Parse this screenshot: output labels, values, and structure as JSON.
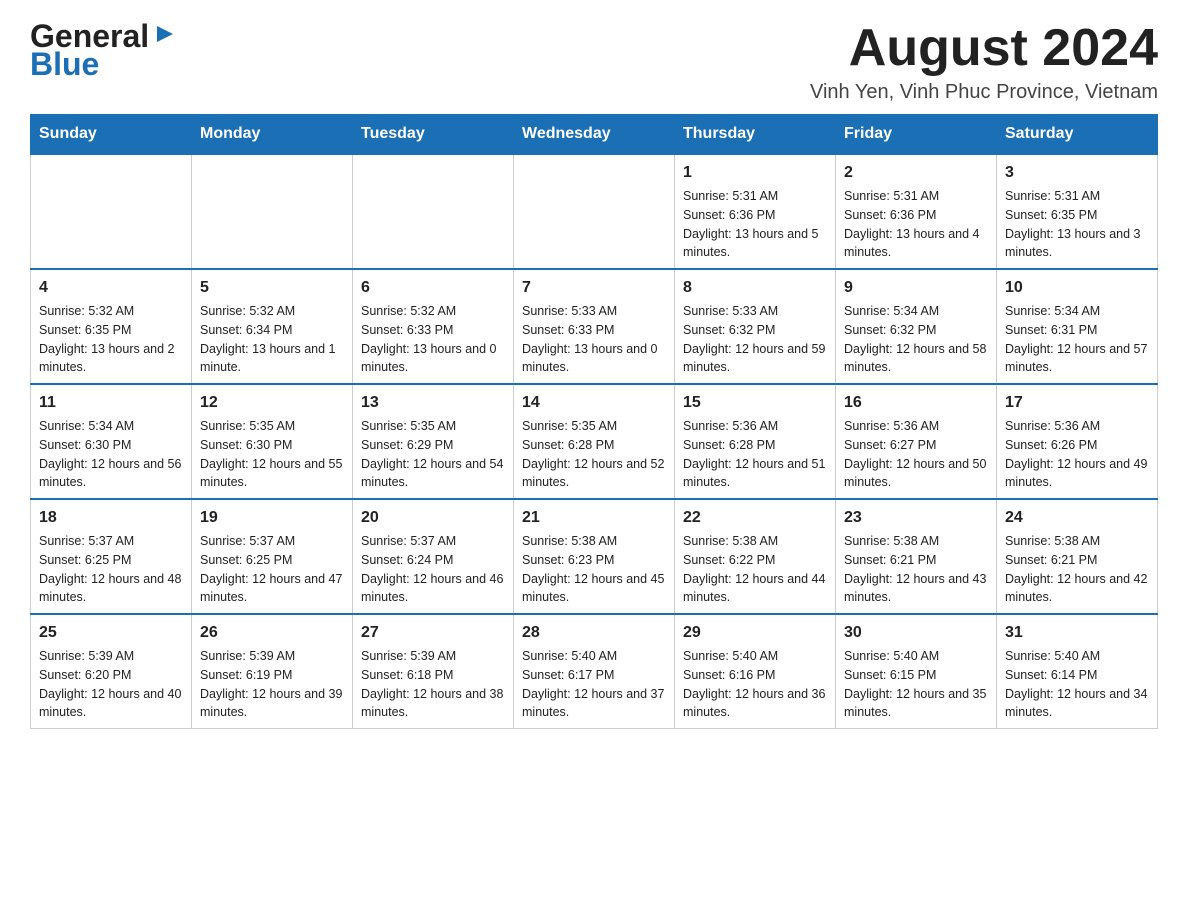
{
  "header": {
    "logo_general": "General",
    "logo_blue": "Blue",
    "main_title": "August 2024",
    "subtitle": "Vinh Yen, Vinh Phuc Province, Vietnam"
  },
  "days_of_week": [
    "Sunday",
    "Monday",
    "Tuesday",
    "Wednesday",
    "Thursday",
    "Friday",
    "Saturday"
  ],
  "weeks": [
    {
      "days": [
        {
          "num": "",
          "info": ""
        },
        {
          "num": "",
          "info": ""
        },
        {
          "num": "",
          "info": ""
        },
        {
          "num": "",
          "info": ""
        },
        {
          "num": "1",
          "info": "Sunrise: 5:31 AM\nSunset: 6:36 PM\nDaylight: 13 hours and 5 minutes."
        },
        {
          "num": "2",
          "info": "Sunrise: 5:31 AM\nSunset: 6:36 PM\nDaylight: 13 hours and 4 minutes."
        },
        {
          "num": "3",
          "info": "Sunrise: 5:31 AM\nSunset: 6:35 PM\nDaylight: 13 hours and 3 minutes."
        }
      ]
    },
    {
      "days": [
        {
          "num": "4",
          "info": "Sunrise: 5:32 AM\nSunset: 6:35 PM\nDaylight: 13 hours and 2 minutes."
        },
        {
          "num": "5",
          "info": "Sunrise: 5:32 AM\nSunset: 6:34 PM\nDaylight: 13 hours and 1 minute."
        },
        {
          "num": "6",
          "info": "Sunrise: 5:32 AM\nSunset: 6:33 PM\nDaylight: 13 hours and 0 minutes."
        },
        {
          "num": "7",
          "info": "Sunrise: 5:33 AM\nSunset: 6:33 PM\nDaylight: 13 hours and 0 minutes."
        },
        {
          "num": "8",
          "info": "Sunrise: 5:33 AM\nSunset: 6:32 PM\nDaylight: 12 hours and 59 minutes."
        },
        {
          "num": "9",
          "info": "Sunrise: 5:34 AM\nSunset: 6:32 PM\nDaylight: 12 hours and 58 minutes."
        },
        {
          "num": "10",
          "info": "Sunrise: 5:34 AM\nSunset: 6:31 PM\nDaylight: 12 hours and 57 minutes."
        }
      ]
    },
    {
      "days": [
        {
          "num": "11",
          "info": "Sunrise: 5:34 AM\nSunset: 6:30 PM\nDaylight: 12 hours and 56 minutes."
        },
        {
          "num": "12",
          "info": "Sunrise: 5:35 AM\nSunset: 6:30 PM\nDaylight: 12 hours and 55 minutes."
        },
        {
          "num": "13",
          "info": "Sunrise: 5:35 AM\nSunset: 6:29 PM\nDaylight: 12 hours and 54 minutes."
        },
        {
          "num": "14",
          "info": "Sunrise: 5:35 AM\nSunset: 6:28 PM\nDaylight: 12 hours and 52 minutes."
        },
        {
          "num": "15",
          "info": "Sunrise: 5:36 AM\nSunset: 6:28 PM\nDaylight: 12 hours and 51 minutes."
        },
        {
          "num": "16",
          "info": "Sunrise: 5:36 AM\nSunset: 6:27 PM\nDaylight: 12 hours and 50 minutes."
        },
        {
          "num": "17",
          "info": "Sunrise: 5:36 AM\nSunset: 6:26 PM\nDaylight: 12 hours and 49 minutes."
        }
      ]
    },
    {
      "days": [
        {
          "num": "18",
          "info": "Sunrise: 5:37 AM\nSunset: 6:25 PM\nDaylight: 12 hours and 48 minutes."
        },
        {
          "num": "19",
          "info": "Sunrise: 5:37 AM\nSunset: 6:25 PM\nDaylight: 12 hours and 47 minutes."
        },
        {
          "num": "20",
          "info": "Sunrise: 5:37 AM\nSunset: 6:24 PM\nDaylight: 12 hours and 46 minutes."
        },
        {
          "num": "21",
          "info": "Sunrise: 5:38 AM\nSunset: 6:23 PM\nDaylight: 12 hours and 45 minutes."
        },
        {
          "num": "22",
          "info": "Sunrise: 5:38 AM\nSunset: 6:22 PM\nDaylight: 12 hours and 44 minutes."
        },
        {
          "num": "23",
          "info": "Sunrise: 5:38 AM\nSunset: 6:21 PM\nDaylight: 12 hours and 43 minutes."
        },
        {
          "num": "24",
          "info": "Sunrise: 5:38 AM\nSunset: 6:21 PM\nDaylight: 12 hours and 42 minutes."
        }
      ]
    },
    {
      "days": [
        {
          "num": "25",
          "info": "Sunrise: 5:39 AM\nSunset: 6:20 PM\nDaylight: 12 hours and 40 minutes."
        },
        {
          "num": "26",
          "info": "Sunrise: 5:39 AM\nSunset: 6:19 PM\nDaylight: 12 hours and 39 minutes."
        },
        {
          "num": "27",
          "info": "Sunrise: 5:39 AM\nSunset: 6:18 PM\nDaylight: 12 hours and 38 minutes."
        },
        {
          "num": "28",
          "info": "Sunrise: 5:40 AM\nSunset: 6:17 PM\nDaylight: 12 hours and 37 minutes."
        },
        {
          "num": "29",
          "info": "Sunrise: 5:40 AM\nSunset: 6:16 PM\nDaylight: 12 hours and 36 minutes."
        },
        {
          "num": "30",
          "info": "Sunrise: 5:40 AM\nSunset: 6:15 PM\nDaylight: 12 hours and 35 minutes."
        },
        {
          "num": "31",
          "info": "Sunrise: 5:40 AM\nSunset: 6:14 PM\nDaylight: 12 hours and 34 minutes."
        }
      ]
    }
  ]
}
